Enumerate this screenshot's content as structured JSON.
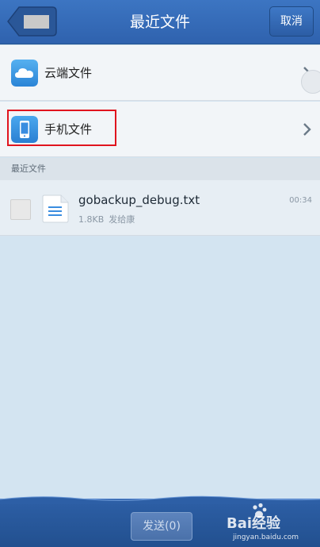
{
  "header": {
    "title": "最近文件",
    "cancel_label": "取消"
  },
  "entries": [
    {
      "label": "云端文件",
      "icon": "cloud-icon"
    },
    {
      "label": "手机文件",
      "icon": "phone-icon"
    }
  ],
  "section": {
    "title": "最近文件"
  },
  "files": [
    {
      "name": "gobackup_debug.txt",
      "size": "1.8KB",
      "sender": "发给康",
      "time": "00:34",
      "icon": "text-file-icon"
    }
  ],
  "footer": {
    "send_label": "发送(0)"
  },
  "watermark": {
    "brand": "Bai经验",
    "url": "jingyan.baidu.com"
  },
  "colors": {
    "header_bg": "#3c75c2",
    "accent_blue": "#3a8de0",
    "highlight": "#e0141e",
    "bottom_bg": "#2d5fa6"
  }
}
